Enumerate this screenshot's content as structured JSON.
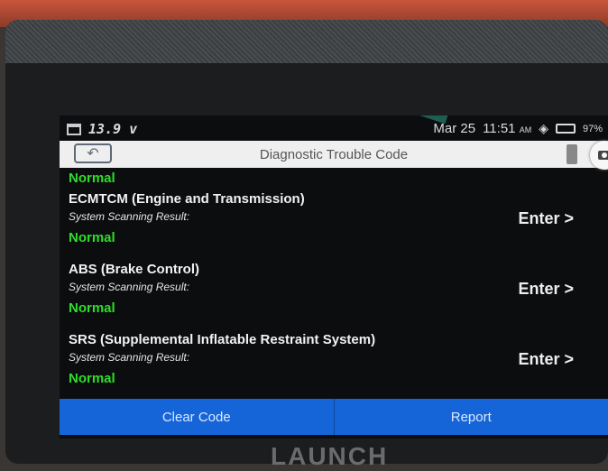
{
  "status_bar": {
    "voltage": "13.9 v",
    "date": "Mar 25",
    "time": "11:51",
    "ampm": "AM",
    "battery": "97%"
  },
  "title_bar": {
    "title": "Diagnostic Trouble Code",
    "back_icon": "back-arrow-icon",
    "camera_icon": "camera-icon"
  },
  "list": {
    "top_status": "Normal",
    "items": [
      {
        "name": "ECMTCM (Engine and Transmission)",
        "sub": "System Scanning Result:",
        "status": "Normal",
        "action": "Enter >"
      },
      {
        "name": "ABS (Brake Control)",
        "sub": "System Scanning Result:",
        "status": "Normal",
        "action": "Enter >"
      },
      {
        "name": "SRS (Supplemental Inflatable Restraint System)",
        "sub": "System Scanning Result:",
        "status": "Normal",
        "action": "Enter >"
      }
    ]
  },
  "bottom_bar": {
    "clear_code": "Clear Code",
    "report": "Report"
  },
  "brand": "LAUNCH",
  "colors": {
    "status_normal": "#2fdc2a",
    "bottom_bar": "#1565d8"
  }
}
